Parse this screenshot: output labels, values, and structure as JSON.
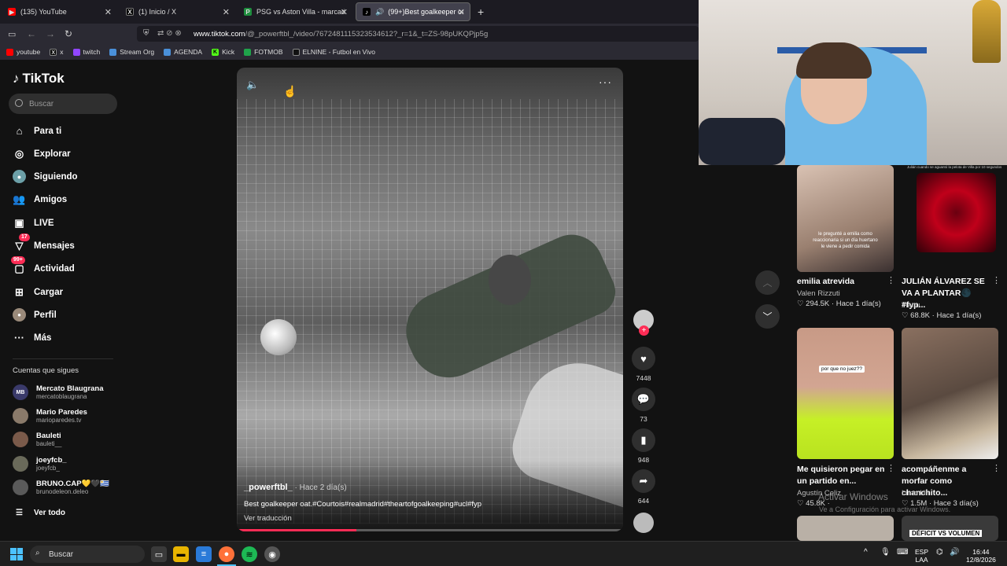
{
  "browser": {
    "tabs": [
      {
        "label": "(135) YouTube",
        "icon": "youtube-icon",
        "color": "#ff0000"
      },
      {
        "label": "(1) Inicio / X",
        "icon": "x-icon",
        "color": "#000000"
      },
      {
        "label": "PSG vs Aston Villa - marcador e",
        "icon": "sheet-icon",
        "color": "#1e8e3e"
      },
      {
        "label": "(99+)Best goalkeeper oat.#",
        "icon": "tiktok-icon",
        "color": "#000000"
      }
    ],
    "url_domain": "www.tiktok.com",
    "url_path": "/@_powerftbl_/video/7672481115323534612?_r=1&_t=ZS-98pUKQPjp5g",
    "bookmarks": [
      "youtube",
      "x",
      "twitch",
      "Stream Org",
      "AGENDA",
      "Kick",
      "FOTMOB",
      "ELNINE - Futbol en Vivo"
    ]
  },
  "sidebar": {
    "logo": "TikTok",
    "search_placeholder": "Buscar",
    "nav": [
      {
        "label": "Para ti",
        "icon": "home-icon"
      },
      {
        "label": "Explorar",
        "icon": "compass-icon"
      },
      {
        "label": "Siguiendo",
        "icon": "following-icon"
      },
      {
        "label": "Amigos",
        "icon": "friends-icon"
      },
      {
        "label": "LIVE",
        "icon": "live-icon"
      },
      {
        "label": "Mensajes",
        "icon": "messages-icon",
        "badge": "17"
      },
      {
        "label": "Actividad",
        "icon": "activity-icon",
        "badge": "99+"
      },
      {
        "label": "Cargar",
        "icon": "upload-icon"
      },
      {
        "label": "Perfil",
        "icon": "profile-icon"
      },
      {
        "label": "Más",
        "icon": "more-icon"
      }
    ],
    "following_title": "Cuentas que sigues",
    "following": [
      {
        "name": "Mercato Blaugrana",
        "handle": "mercatoblaugrana",
        "initials": "MB"
      },
      {
        "name": "Mario Paredes",
        "handle": "marioparedes.tv",
        "initials": ""
      },
      {
        "name": "Bauleti",
        "handle": "bauleti__",
        "initials": ""
      },
      {
        "name": "joeyfcb_",
        "handle": "joeyfcb_",
        "initials": ""
      },
      {
        "name": "BRUNO.CAP💛🖤🇺🇾",
        "handle": "brunodeleon.deleo",
        "initials": ""
      }
    ],
    "see_all": "Ver todo"
  },
  "video": {
    "author": "_powerftbl_",
    "posted": " · Hace 2 día(s)",
    "description": "Best goalkeeper oat.#Courtois#realmadrid#theartofgoalkeeping#ucl#fyp",
    "translate": "Ver traducción",
    "progress": 0.31,
    "likes": "7448",
    "comments": "73",
    "saves": "948",
    "shares": "644"
  },
  "recommended": [
    {
      "title": "emilia atrevida",
      "author": "Valen Rizzuti",
      "likes": "294.5K",
      "time": "Hace 1 día(s)",
      "caption": "le pregunté a emilia como reaccionaria si un día huertano le viene a pedir comida"
    },
    {
      "title": "JULIÁN ÁLVAREZ SE VA A PLANTAR🌑 #fyp...",
      "author": "Tianu",
      "likes": "68.8K",
      "time": "Hace 1 día(s)",
      "caption": ""
    },
    {
      "title": "Me quisieron pegar en un partido en...",
      "author": "Agustín Celiz",
      "likes": "45.8K",
      "time": "",
      "caption": "por que no juez??"
    },
    {
      "title": "acompáñenme a morfar como chanchito...",
      "author": "Limo Uh",
      "likes": "1.5M",
      "time": "Hace 3 día(s)",
      "caption": ""
    }
  ],
  "reco_top_caption": "Julián cuando se aguantó la pelota de Villa por 10 segundos",
  "reco_bottom_caption": "DÉFICIT VS VOLUMEN",
  "windows_watermark": {
    "line1": "Activar Windows",
    "line2": "Ve a Configuración para activar Windows."
  },
  "taskbar": {
    "search_label": "Buscar",
    "lang_top": "ESP",
    "lang_bottom": "LAA",
    "time": "16:44",
    "date": "12/8/2026"
  },
  "colors": {
    "accent": "#fe2c55",
    "windows_blue": "#4cc2ff"
  }
}
